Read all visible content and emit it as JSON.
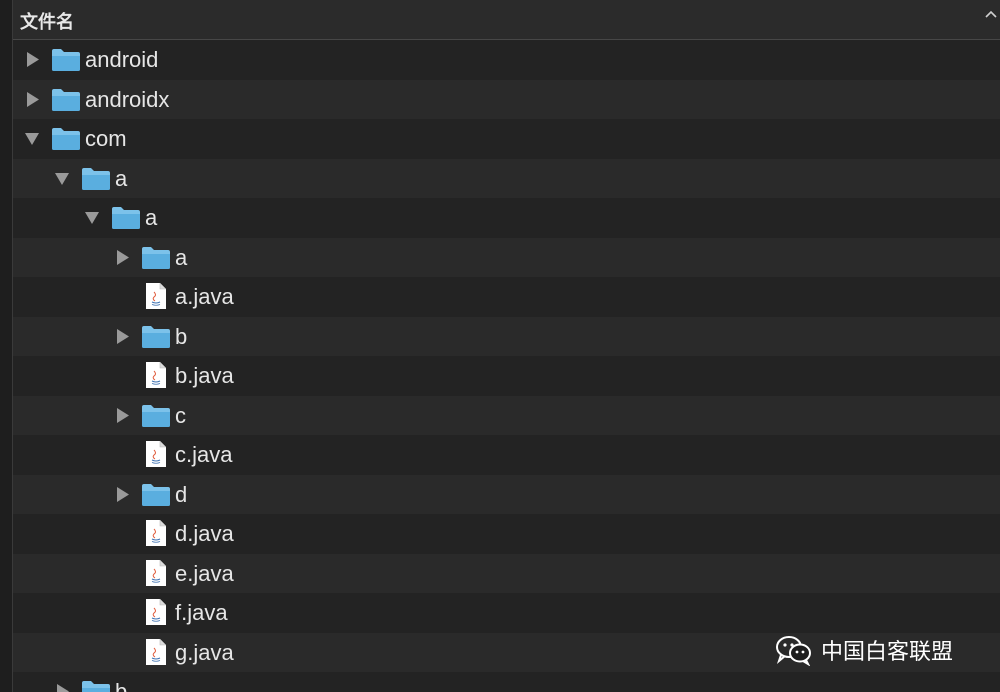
{
  "header": {
    "column_label": "文件名",
    "sort_icon": "chevron-up-icon"
  },
  "rows": [
    {
      "name": "android",
      "kind": "folder",
      "depth": 0,
      "state": "collapsed"
    },
    {
      "name": "androidx",
      "kind": "folder",
      "depth": 0,
      "state": "collapsed"
    },
    {
      "name": "com",
      "kind": "folder",
      "depth": 0,
      "state": "expanded"
    },
    {
      "name": "a",
      "kind": "folder",
      "depth": 1,
      "state": "expanded"
    },
    {
      "name": "a",
      "kind": "folder",
      "depth": 2,
      "state": "expanded"
    },
    {
      "name": "a",
      "kind": "folder",
      "depth": 3,
      "state": "collapsed"
    },
    {
      "name": "a.java",
      "kind": "java-file",
      "depth": 3
    },
    {
      "name": "b",
      "kind": "folder",
      "depth": 3,
      "state": "collapsed"
    },
    {
      "name": "b.java",
      "kind": "java-file",
      "depth": 3
    },
    {
      "name": "c",
      "kind": "folder",
      "depth": 3,
      "state": "collapsed"
    },
    {
      "name": "c.java",
      "kind": "java-file",
      "depth": 3
    },
    {
      "name": "d",
      "kind": "folder",
      "depth": 3,
      "state": "collapsed"
    },
    {
      "name": "d.java",
      "kind": "java-file",
      "depth": 3
    },
    {
      "name": "e.java",
      "kind": "java-file",
      "depth": 3
    },
    {
      "name": "f.java",
      "kind": "java-file",
      "depth": 3
    },
    {
      "name": "g.java",
      "kind": "java-file",
      "depth": 3
    },
    {
      "name": "b",
      "kind": "folder",
      "depth": 1,
      "state": "collapsed"
    }
  ],
  "watermark": {
    "text": "中国白客联盟",
    "icon": "wechat-icon"
  },
  "colors": {
    "folder": "#5aaedf",
    "folder_tab": "#7cc2ea",
    "row_odd": "#232323",
    "row_even": "#2a2a2a",
    "text": "#e6e6e6",
    "disclosure": "#9a9a9a"
  }
}
